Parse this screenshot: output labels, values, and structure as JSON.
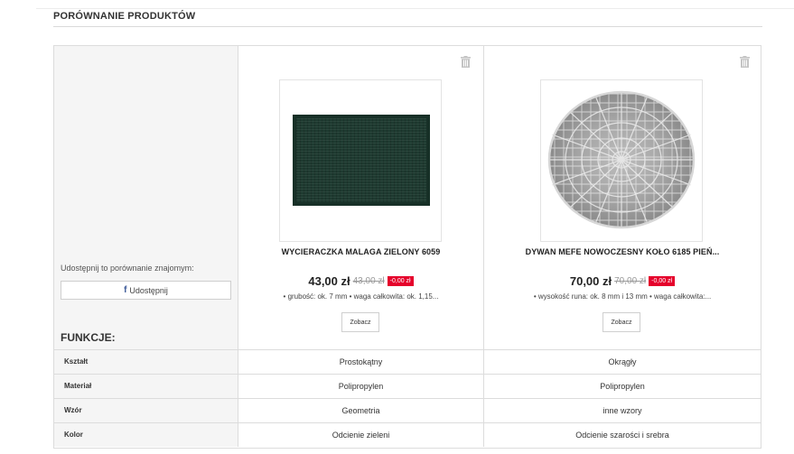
{
  "page": {
    "title": "PORÓWNANIE PRODUKTÓW"
  },
  "share": {
    "text": "Udostępnij to porównanie znajomym:",
    "button_label": "Udostępnij",
    "button_icon": "f"
  },
  "features_heading": "FUNKCJE:",
  "products": [
    {
      "name": "WYCIERACZKA MALAGA ZIELONY 6059",
      "price": "43,00 zł",
      "old_price": "43,00 zł",
      "discount": "-0,00 zł",
      "attrs": "• grubość: ok. 7 mm • waga całkowita: ok. 1,15...",
      "see_label": "Zobacz"
    },
    {
      "name": "DYWAN MEFE NOWOCZESNY KOŁO 6185 PIEŃ...",
      "price": "70,00 zł",
      "old_price": "70,00 zł",
      "discount": "-0,00 zł",
      "attrs": "• wysokość runa: ok. 8 mm i 13 mm • waga całkowita:...",
      "see_label": "Zobacz"
    }
  ],
  "features": [
    {
      "label": "Kształt",
      "values": [
        "Prostokątny",
        "Okrągły"
      ]
    },
    {
      "label": "Materiał",
      "values": [
        "Polipropylen",
        "Polipropylen"
      ]
    },
    {
      "label": "Wzór",
      "values": [
        "Geometria",
        "inne wzory"
      ]
    },
    {
      "label": "Kolor",
      "values": [
        "Odcienie zieleni",
        "Odcienie szarości i srebra"
      ]
    }
  ],
  "colors": {
    "discount_badge": "#e5002b",
    "border": "#dcdcdc",
    "label_bg": "#f5f5f5"
  }
}
